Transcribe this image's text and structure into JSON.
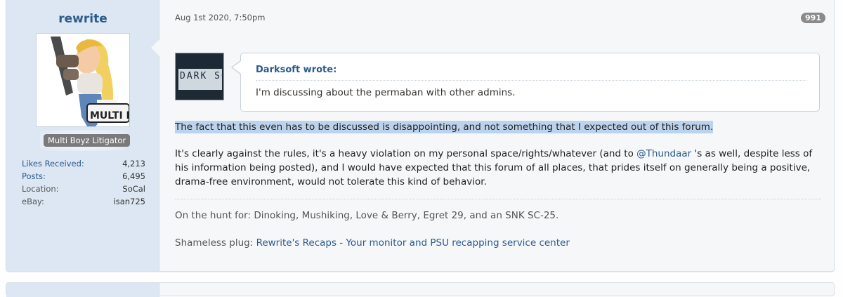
{
  "user": {
    "username": "rewrite",
    "title": "Multi Boyz Litigator",
    "stats": [
      {
        "label": "Likes Received:",
        "value": "4,213",
        "link": true
      },
      {
        "label": "Posts:",
        "value": "6,495",
        "link": true
      },
      {
        "label": "Location:",
        "value": "SoCal",
        "link": false
      },
      {
        "label": "eBay:",
        "value": "isan725",
        "link": false
      }
    ]
  },
  "post": {
    "date": "Aug 1st 2020, 7:50pm",
    "number": "991",
    "quote": {
      "author": "Darksoft wrote:",
      "text": "I'm discussing about the permaban with other admins.",
      "avatar_text": "DARK SOFT"
    },
    "paragraph1": "The fact that this even has to be discussed is disappointing, and not something that I expected out of this forum.",
    "paragraph2_before": "It's clearly against the rules, it's a heavy violation on my personal space/rights/whatever (and to ",
    "mention": "@Thundaar",
    "paragraph2_after": " 's as well, despite less of his information being posted), and I would have expected that this forum of all places, that prides itself on generally being a positive, drama-free environment, would not tolerate this kind of behavior.",
    "signature": {
      "line1": "On the hunt for: Dinoking, Mushiking, Love & Berry, Egret 29, and an SNK SC-25.",
      "line2_prefix": "Shameless plug: ",
      "line2_link": "Rewrite's Recaps - Your monitor and PSU recapping service center"
    }
  },
  "avatar_badge_text": "MULTI BOYZ",
  "colors": {
    "accent": "#2c5a8c",
    "user_column": "#dce7f3",
    "highlight": "#bcd3ee",
    "badge": "#7a7a7a"
  }
}
